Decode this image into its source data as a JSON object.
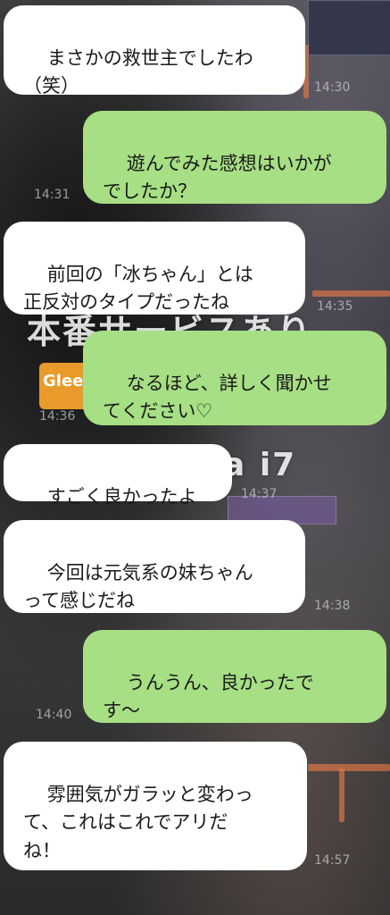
{
  "background": {
    "overlay_text": "本番サービスあり",
    "overlay_brand_a": "Glee",
    "overlay_brand_b": "a i7"
  },
  "messages": [
    {
      "side": "left",
      "text": "まさかの救世主でしたわ\n（笑）",
      "time": "14:30"
    },
    {
      "side": "right",
      "text": "遊んでみた感想はいかが\nでしたか？",
      "time": "14:31"
    },
    {
      "side": "left",
      "text": "前回の「冰ちゃん」とは\n正反対のタイプだったね",
      "time": "14:35"
    },
    {
      "side": "right",
      "text": "なるほど、詳しく聞かせ\nてください♡",
      "time": "14:36"
    },
    {
      "side": "left",
      "text": "すごく良かったよ",
      "time": "14:37"
    },
    {
      "side": "left",
      "text": "今回は元気系の妹ちゃん\nって感じだね",
      "time": "14:38"
    },
    {
      "side": "right",
      "text": "うんうん、良かったで\nす～",
      "time": "14:40"
    },
    {
      "side": "left",
      "text": "雰囲気がガラッと変わっ\nて、これはこれでアリだ\nね！",
      "time": "14:57"
    }
  ],
  "colors": {
    "left_bubble": "#ffffff",
    "right_bubble": "#a6df84",
    "text": "#1a1a1a"
  }
}
